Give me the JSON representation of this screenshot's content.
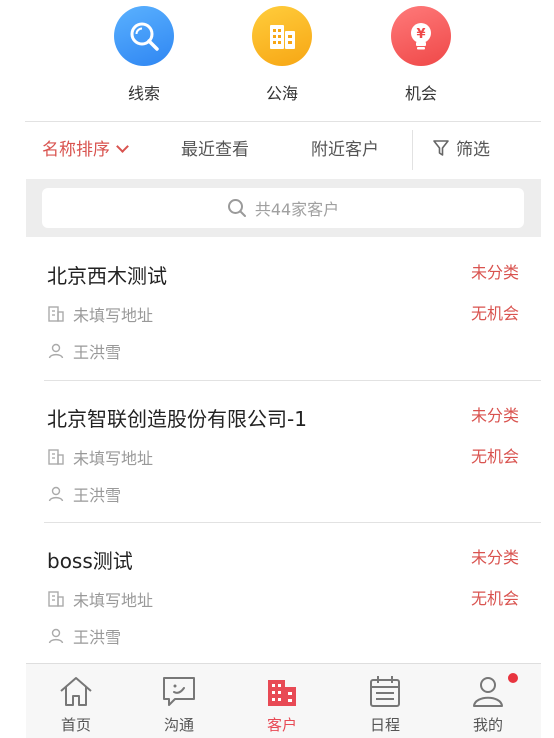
{
  "quick_actions": [
    {
      "label": "线索",
      "icon": "search-icon",
      "color": "#3f97f8"
    },
    {
      "label": "公海",
      "icon": "building-icon",
      "color": "#f9b322"
    },
    {
      "label": "机会",
      "icon": "bulb-yuan-icon",
      "color": "#f35a5a"
    }
  ],
  "filters": {
    "sort_label": "名称排序",
    "recent_label": "最近查看",
    "nearby_label": "附近客户",
    "screen_label": "筛选"
  },
  "search": {
    "placeholder": "共44家客户"
  },
  "customers": [
    {
      "name": "北京西木测试",
      "address": "未填写地址",
      "owner": "王洪雪",
      "category": "未分类",
      "opportunity": "无机会"
    },
    {
      "name": "北京智联创造股份有限公司-1",
      "address": "未填写地址",
      "owner": "王洪雪",
      "category": "未分类",
      "opportunity": "无机会"
    },
    {
      "name": "boss测试",
      "address": "未填写地址",
      "owner": "王洪雪",
      "category": "未分类",
      "opportunity": "无机会"
    }
  ],
  "tabs": [
    {
      "label": "首页",
      "icon": "home-icon"
    },
    {
      "label": "沟通",
      "icon": "chat-icon"
    },
    {
      "label": "客户",
      "icon": "customer-building-icon",
      "active": true
    },
    {
      "label": "日程",
      "icon": "calendar-icon"
    },
    {
      "label": "我的",
      "icon": "user-icon",
      "badge": true
    }
  ],
  "colors": {
    "accent": "#e84a55",
    "tag_red": "#d9534f",
    "muted": "#999999"
  }
}
